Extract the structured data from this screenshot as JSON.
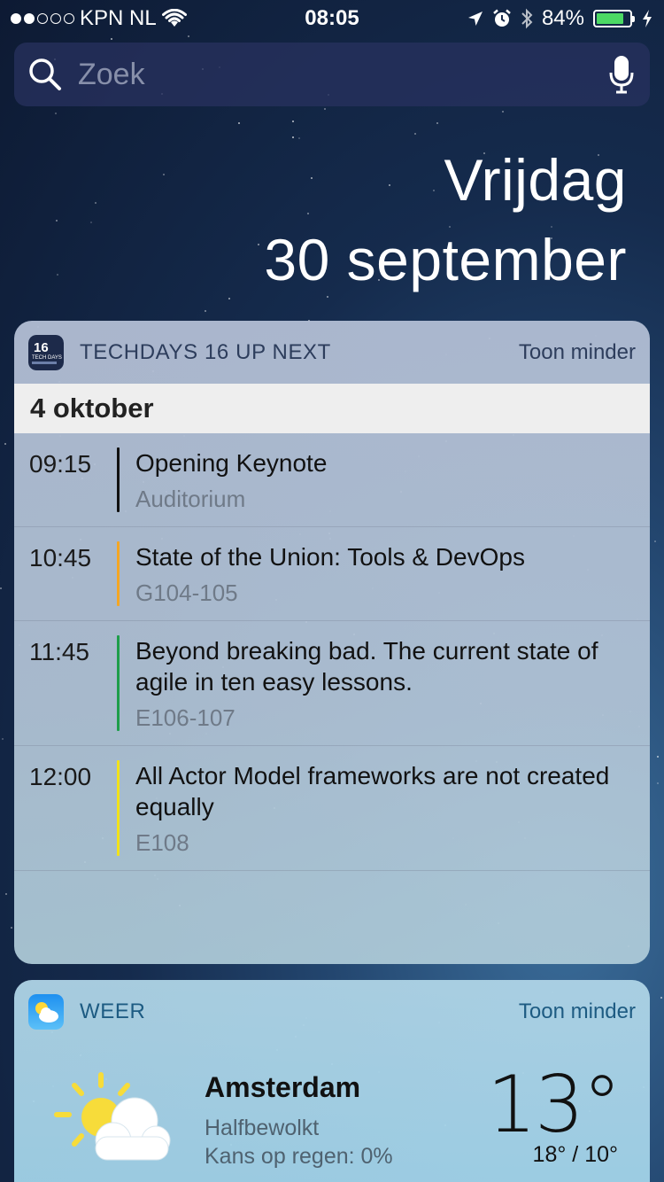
{
  "status_bar": {
    "signal_dots_filled": 2,
    "signal_dots_total": 5,
    "carrier": "KPN NL",
    "time": "08:05",
    "battery_percent": "84%",
    "battery_level": 0.84,
    "colors": {
      "battery_fill": "#4cd964"
    }
  },
  "search": {
    "placeholder": "Zoek"
  },
  "date": {
    "weekday": "Vrijdag",
    "day_month": "30 september"
  },
  "techdays_widget": {
    "title": "TECHDAYS 16 UP NEXT",
    "action": "Toon minder",
    "day": "4 oktober",
    "sessions": [
      {
        "time": "09:15",
        "title": "Opening Keynote",
        "room": "Auditorium",
        "color": "#111111"
      },
      {
        "time": "10:45",
        "title": "State of the Union: Tools & DevOps",
        "room": "G104-105",
        "color": "#f5a623"
      },
      {
        "time": "11:45",
        "title": "Beyond breaking bad. The current state of agile in ten easy lessons.",
        "room": "E106-107",
        "color": "#1e9e4a"
      },
      {
        "time": "12:00",
        "title": "All Actor Model frameworks are not created equally",
        "room": "E108",
        "color": "#f2e21a"
      }
    ]
  },
  "weather_widget": {
    "title": "WEER",
    "action": "Toon minder",
    "city": "Amsterdam",
    "condition": "Halfbewolkt",
    "rain_chance": "Kans op regen: 0%",
    "temperature": "13°",
    "min_max": "18° / 10°",
    "icon": "partly-cloudy-icon"
  }
}
